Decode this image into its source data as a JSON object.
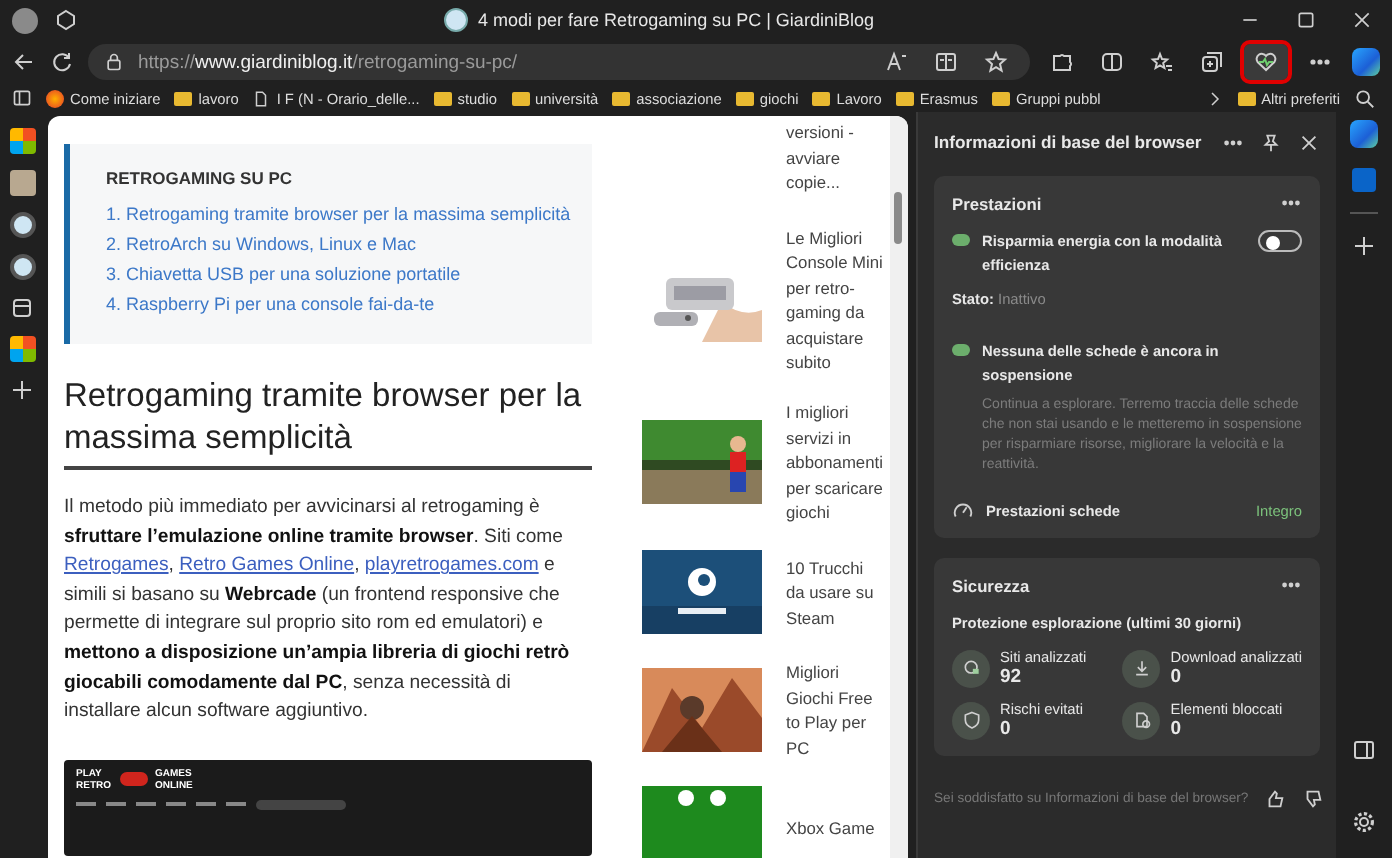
{
  "window": {
    "title": "4 modi per fare Retrogaming su PC | GiardiniBlog"
  },
  "address_bar": {
    "scheme": "https://",
    "domain": "www.giardiniblog.it",
    "path": "/retrogaming-su-pc/"
  },
  "toolbar": [
    {
      "kind": "read-aloud",
      "selected": false
    },
    {
      "kind": "reader",
      "selected": false
    },
    {
      "kind": "star",
      "selected": false
    },
    {
      "kind": "puzzle",
      "selected": false
    },
    {
      "kind": "split",
      "selected": false
    },
    {
      "kind": "favorites",
      "selected": false
    },
    {
      "kind": "collections",
      "selected": false
    },
    {
      "kind": "heart-pulse",
      "selected": true
    },
    {
      "kind": "more",
      "selected": false
    }
  ],
  "bookmarks": [
    {
      "kind": "browser",
      "label": "Come iniziare"
    },
    {
      "kind": "folder",
      "label": "lavoro"
    },
    {
      "kind": "page",
      "label": "I F (N - Orario_delle..."
    },
    {
      "kind": "folder",
      "label": "studio"
    },
    {
      "kind": "folder",
      "label": "università"
    },
    {
      "kind": "folder",
      "label": "associazione"
    },
    {
      "kind": "folder",
      "label": "giochi"
    },
    {
      "kind": "folder",
      "label": "Lavoro"
    },
    {
      "kind": "folder",
      "label": "Erasmus"
    },
    {
      "kind": "folder",
      "label": "Gruppi pubbl"
    }
  ],
  "other_bookmarks": {
    "label": "Altri preferiti"
  },
  "article": {
    "toc": {
      "title": "RETROGAMING SU PC",
      "items": [
        "1. Retrogaming tramite browser per la massima semplicità",
        "2. RetroArch su Windows, Linux e Mac",
        "3. Chiavetta USB per una soluzione portatile",
        "4. Raspberry Pi per una console fai-da-te"
      ]
    },
    "heading": "Retrogaming tramite browser per la massima semplicità",
    "paragraph": [
      {
        "kind": "plain",
        "text": "Il metodo più immediato per avvicinarsi al retrogaming è "
      },
      {
        "kind": "bold",
        "text": "sfruttare l’emulazione online tramite browser"
      },
      {
        "kind": "plain",
        "text": ". Siti come "
      },
      {
        "kind": "link",
        "text": "Retrogames"
      },
      {
        "kind": "plain",
        "text": ", "
      },
      {
        "kind": "link",
        "text": "Retro Games Online"
      },
      {
        "kind": "plain",
        "text": ", "
      },
      {
        "kind": "link",
        "text": "playretrogames.com"
      },
      {
        "kind": "plain",
        "text": " e simili si basano su "
      },
      {
        "kind": "bold",
        "text": "Webrcade"
      },
      {
        "kind": "plain",
        "text": " (un frontend responsive che permette di integrare sul proprio sito rom ed emulatori) e "
      },
      {
        "kind": "bold",
        "text": "mettono a disposizione un’ampia libreria di giochi retrò giocabili comodamente dal PC"
      },
      {
        "kind": "plain",
        "text": ", senza necessità di installare alcun software aggiuntivo."
      }
    ],
    "screenshot": {
      "logo_left": [
        "PLAY",
        "RETRO"
      ],
      "logo_right": [
        "GAMES",
        "ONLINE"
      ]
    }
  },
  "related": [
    {
      "title": "versioni - avviare copie..."
    },
    {
      "title": "Le Migliori Console Mini per retro-gaming da acquistare subito",
      "kind": "picture"
    },
    {
      "title": "I migliori servizi in abbonamenti per scaricare giochi",
      "kind": "picture"
    },
    {
      "title": "10 Trucchi da usare su Steam",
      "kind": "picture"
    },
    {
      "title": "Migliori Giochi Free to Play per PC",
      "kind": "picture"
    },
    {
      "title": "Xbox Game",
      "kind": "picture"
    }
  ],
  "side_panel": {
    "title": "Informazioni di base del browser",
    "performance": {
      "title": "Prestazioni",
      "efficiency": {
        "label": "Risparmia energia con la modalità efficienza",
        "on": false,
        "status_label": "Stato:",
        "status_value": "Inattivo"
      },
      "sleeping": {
        "title": "Nessuna delle schede è ancora in sospensione",
        "description": "Continua a esplorare. Terremo traccia delle schede che non stai usando e le metteremo in sospensione per risparmiare risorse, migliorare la velocità e la reattività."
      },
      "tab_performance": {
        "label": "Prestazioni schede",
        "value": "Integro"
      }
    },
    "security": {
      "title": "Sicurezza",
      "subtitle": "Protezione esplorazione (ultimi 30 giorni)",
      "stats": [
        {
          "kind": "globe-lock",
          "label": "Siti analizzati",
          "value": "92"
        },
        {
          "kind": "download",
          "label": "Download analizzati",
          "value": "0"
        },
        {
          "kind": "shield",
          "label": "Rischi evitati",
          "value": "0"
        },
        {
          "kind": "blocked",
          "label": "Elementi bloccati",
          "value": "0"
        }
      ]
    },
    "feedback": {
      "question": "Sei soddisfatto su Informazioni di base del browser?"
    }
  }
}
